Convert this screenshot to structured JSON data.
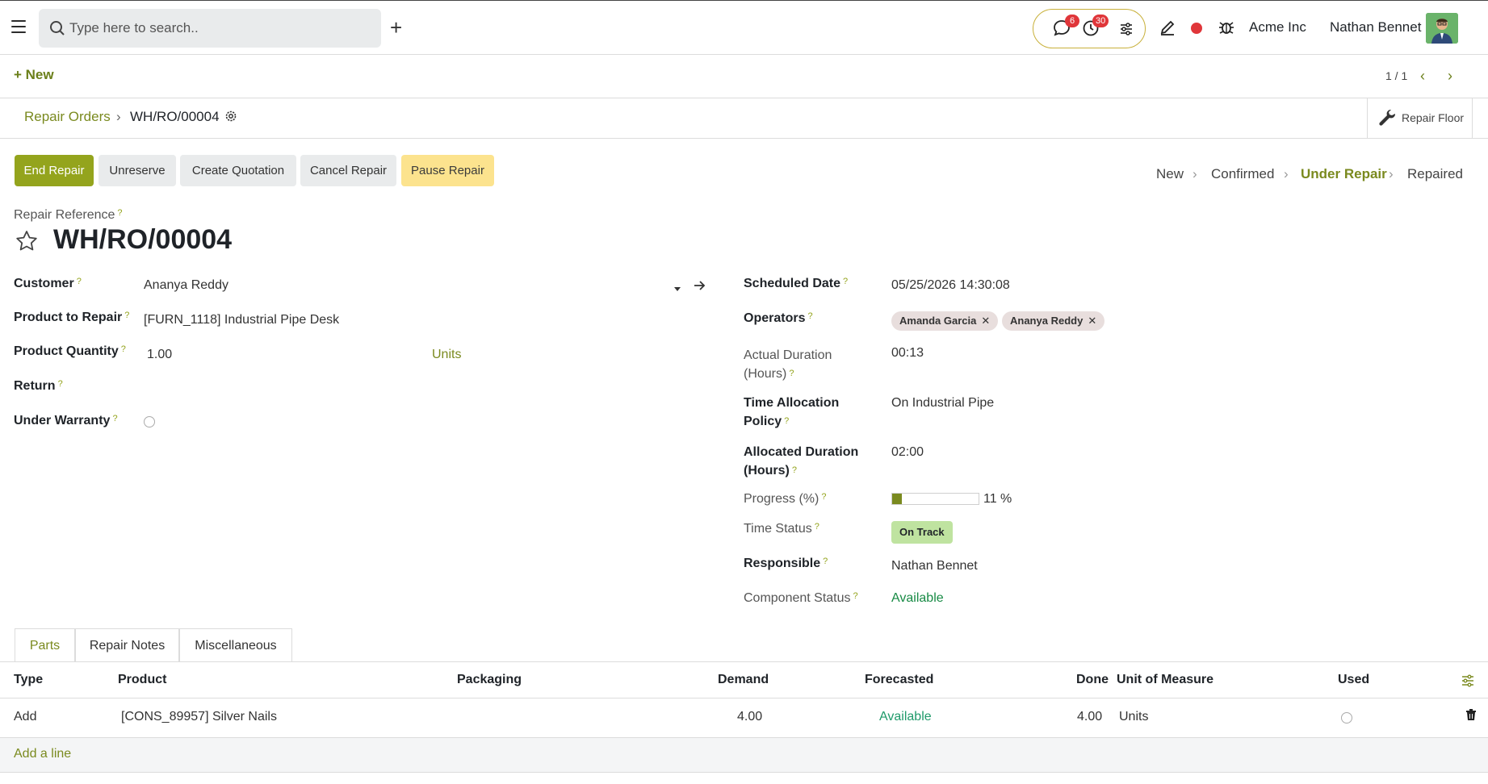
{
  "topbar": {
    "search_placeholder": "Type here to search..",
    "messages_count": "6",
    "activities_count": "30",
    "company": "Acme Inc",
    "user": "Nathan Bennet"
  },
  "controlbar": {
    "new_label": "New",
    "pager": "1 / 1"
  },
  "breadcrumb": {
    "parent": "Repair Orders",
    "current": "WH/RO/00004",
    "floor_button": "Repair Floor"
  },
  "actions": {
    "end_repair": "End Repair",
    "unreserve": "Unreserve",
    "create_quotation": "Create Quotation",
    "cancel_repair": "Cancel Repair",
    "pause_repair": "Pause Repair"
  },
  "stages": [
    "New",
    "Confirmed",
    "Under Repair",
    "Repaired"
  ],
  "active_stage": "Under Repair",
  "form": {
    "reference_label": "Repair Reference",
    "reference": "WH/RO/00004",
    "left": {
      "customer_label": "Customer",
      "customer": "Ananya Reddy",
      "product_label": "Product to Repair",
      "product": "[FURN_1118] Industrial Pipe Desk",
      "quantity_label": "Product Quantity",
      "quantity": "1.00",
      "uom": "Units",
      "return_label": "Return",
      "warranty_label": "Under Warranty"
    },
    "right": {
      "scheduled_label": "Scheduled Date",
      "scheduled": "05/25/2026 14:30:08",
      "operators_label": "Operators",
      "operators": [
        "Amanda Garcia",
        "Ananya Reddy"
      ],
      "actual_duration_label_1": "Actual Duration",
      "actual_duration_label_2": "(Hours)",
      "actual_duration": "00:13",
      "policy_label_1": "Time Allocation",
      "policy_label_2": "Policy",
      "policy": "On Industrial Pipe",
      "allocated_label_1": "Allocated Duration",
      "allocated_label_2": "(Hours)",
      "allocated": "02:00",
      "progress_label": "Progress (%)",
      "progress_value": 11,
      "progress_text": "11 %",
      "time_status_label": "Time Status",
      "time_status": "On Track",
      "responsible_label": "Responsible",
      "responsible": "Nathan Bennet",
      "component_label": "Component Status",
      "component": "Available"
    }
  },
  "tabs": [
    "Parts",
    "Repair Notes",
    "Miscellaneous"
  ],
  "table": {
    "headers": [
      "Type",
      "Product",
      "Packaging",
      "Demand",
      "Forecasted",
      "Done",
      "Unit of Measure",
      "Used"
    ],
    "rows": [
      {
        "type": "Add",
        "product": "[CONS_89957] Silver Nails",
        "packaging": "",
        "demand": "4.00",
        "forecasted": "Available",
        "done": "4.00",
        "uom": "Units"
      }
    ],
    "add_line": "Add a line"
  },
  "colors": {
    "brand": "#94a41d",
    "link": "#7a8a1f",
    "warn": "#fce38e",
    "badge_red": "#e0363a",
    "on_track": "#bfe3a0"
  }
}
